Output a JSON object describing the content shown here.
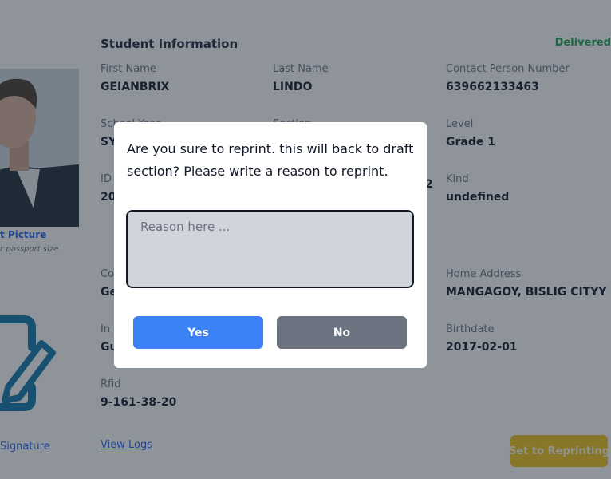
{
  "student_info": {
    "title": "Student Information",
    "status": "Delivered"
  },
  "fields": [
    {
      "label": "First Name",
      "value": "GEIANBRIX"
    },
    {
      "label": "Last Name",
      "value": "LINDO"
    },
    {
      "label": "Contact Person Number",
      "value": "639662133463"
    },
    {
      "label": "School Year",
      "value": "SY"
    },
    {
      "label": "Section",
      "value": ""
    },
    {
      "label": "Level",
      "value": "Grade 1"
    },
    {
      "label": "ID",
      "value": "20"
    },
    {
      "label": "",
      "value": "2"
    },
    {
      "label": "Kind",
      "value": "undefined"
    },
    {
      "label": "Co",
      "value": "Ge"
    },
    {
      "label": "Home Address",
      "value": "MANGAGOY, BISLIG CITYY"
    },
    {
      "label": "In",
      "value": "Gu"
    },
    {
      "label": "Birthdate",
      "value": "2017-02-01"
    },
    {
      "label": "Rfid",
      "value": "9-161-38-20"
    }
  ],
  "photo": {
    "caption": "t Picture",
    "subcaption": "r passport size"
  },
  "signature": {
    "caption": "Signature",
    "icon": "signature-edit-icon"
  },
  "view_logs_label": "View Logs",
  "reprint_button_label": "Set to Reprinting",
  "modal": {
    "message": "Are you sure to reprint. this will back to draft section? Please write a reason to reprint.",
    "reason_placeholder": "Reason here ...",
    "reason_value": "",
    "yes_label": "Yes",
    "no_label": "No"
  },
  "colors": {
    "accent": "#3b82f6",
    "status_green": "#16a34a",
    "reprint_yellow": "#f0c419",
    "no_button_gray": "#6b7280"
  }
}
